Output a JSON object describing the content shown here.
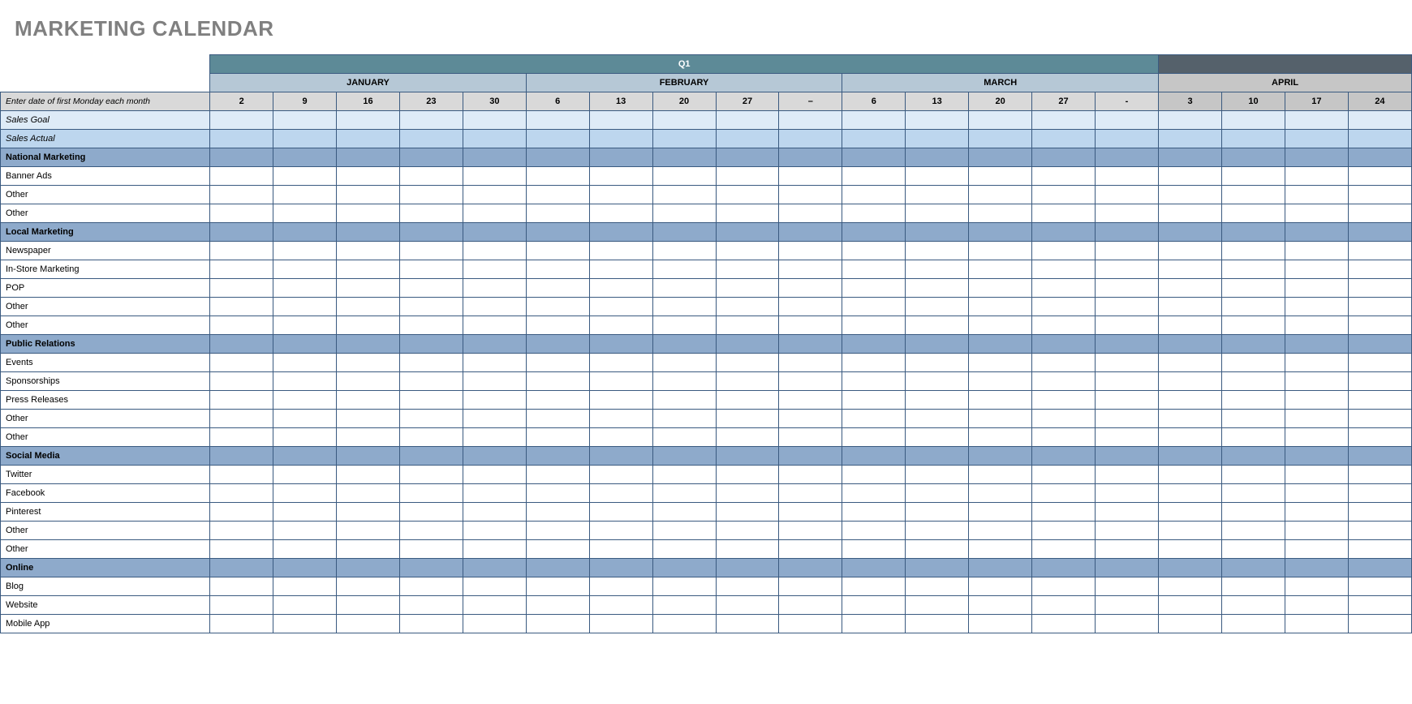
{
  "title": "MARKETING CALENDAR",
  "quarter": "Q1",
  "months": [
    {
      "name": "JANUARY",
      "weeks": [
        "2",
        "9",
        "16",
        "23",
        "30"
      ]
    },
    {
      "name": "FEBRUARY",
      "weeks": [
        "6",
        "13",
        "20",
        "27",
        "–"
      ]
    },
    {
      "name": "MARCH",
      "weeks": [
        "6",
        "13",
        "20",
        "27",
        "-"
      ]
    },
    {
      "name": "APRIL",
      "weeks": [
        "3",
        "10",
        "17",
        "24"
      ]
    }
  ],
  "labels": {
    "dateRow": "Enter date of first Monday each month",
    "salesGoal": "Sales Goal",
    "salesActual": "Sales Actual"
  },
  "sections": [
    {
      "name": "National Marketing",
      "items": [
        "Banner Ads",
        "Other",
        "Other"
      ]
    },
    {
      "name": "Local Marketing",
      "items": [
        "Newspaper",
        "In-Store Marketing",
        "POP",
        "Other",
        "Other"
      ]
    },
    {
      "name": "Public Relations",
      "items": [
        "Events",
        "Sponsorships",
        "Press Releases",
        "Other",
        "Other"
      ]
    },
    {
      "name": "Social Media",
      "items": [
        "Twitter",
        "Facebook",
        "Pinterest",
        "Other",
        "Other"
      ]
    },
    {
      "name": "Online",
      "items": [
        "Blog",
        "Website",
        "Mobile App"
      ]
    }
  ]
}
